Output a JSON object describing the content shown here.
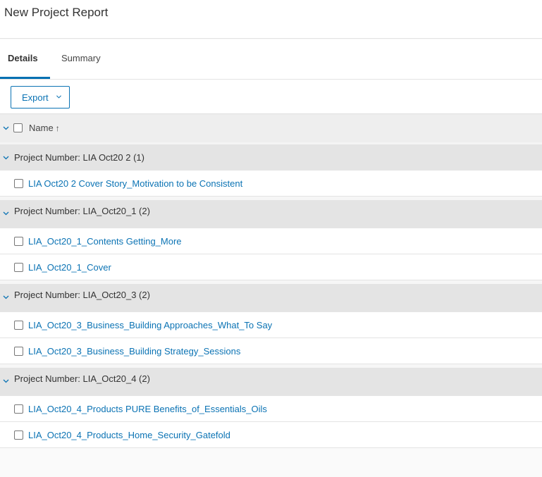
{
  "page": {
    "title": "New Project Report"
  },
  "tabs": [
    {
      "label": "Details",
      "active": true
    },
    {
      "label": "Summary",
      "active": false
    }
  ],
  "toolbar": {
    "export_label": "Export"
  },
  "table": {
    "column_name": "Name",
    "sort_indicator": "↑",
    "groups": [
      {
        "label": "Project Number: LIA Oct20 2 (1)",
        "items": [
          "LIA Oct20 2 Cover Story_Motivation to be Consistent"
        ]
      },
      {
        "label": "Project Number: LIA_Oct20_1 (2)",
        "items": [
          "LIA_Oct20_1_Contents Getting_More",
          "LIA_Oct20_1_Cover"
        ]
      },
      {
        "label": "Project Number: LIA_Oct20_3 (2)",
        "items": [
          "LIA_Oct20_3_Business_Building Approaches_What_To Say",
          "LIA_Oct20_3_Business_Building Strategy_Sessions"
        ]
      },
      {
        "label": "Project Number: LIA_Oct20_4 (2)",
        "items": [
          "LIA_Oct20_4_Products PURE Benefits_of_Essentials_Oils",
          "LIA_Oct20_4_Products_Home_Security_Gatefold"
        ]
      }
    ]
  },
  "colors": {
    "accent": "#0b73b4",
    "group_bg": "#e4e4e4",
    "header_bg": "#eeeeee"
  },
  "icons": {
    "collapse": "chevron-down-icon",
    "export_dropdown": "chevron-down-icon"
  }
}
